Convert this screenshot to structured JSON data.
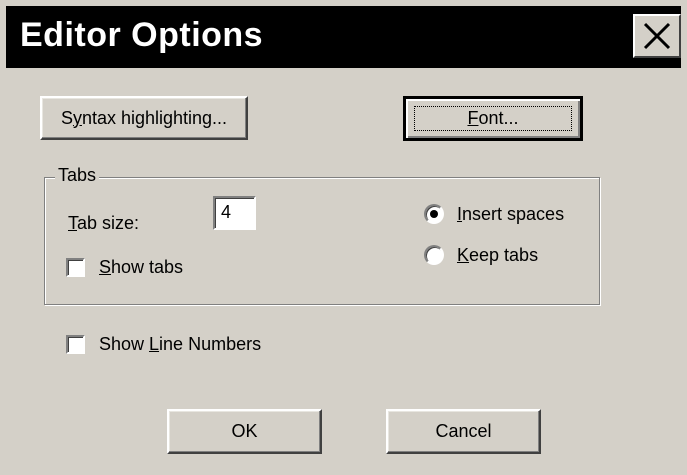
{
  "window": {
    "title": "Editor Options"
  },
  "buttons": {
    "syntax": {
      "pre": "S",
      "key": "y",
      "post": "ntax highlighting..."
    },
    "font": {
      "pre": "",
      "key": "F",
      "post": "ont..."
    },
    "ok": "OK",
    "cancel": "Cancel"
  },
  "tabs_group": {
    "legend": "Tabs",
    "tab_size": {
      "key": "T",
      "post": "ab size:",
      "value": "4"
    },
    "show_tabs": {
      "key": "S",
      "post": "how tabs",
      "checked": false
    },
    "insert_spaces": {
      "key": "I",
      "post": "nsert spaces",
      "selected": true
    },
    "keep_tabs": {
      "key": "K",
      "post": "eep tabs",
      "selected": false
    }
  },
  "show_line_numbers": {
    "pre": "Show ",
    "key": "L",
    "post": "ine Numbers",
    "checked": false
  }
}
